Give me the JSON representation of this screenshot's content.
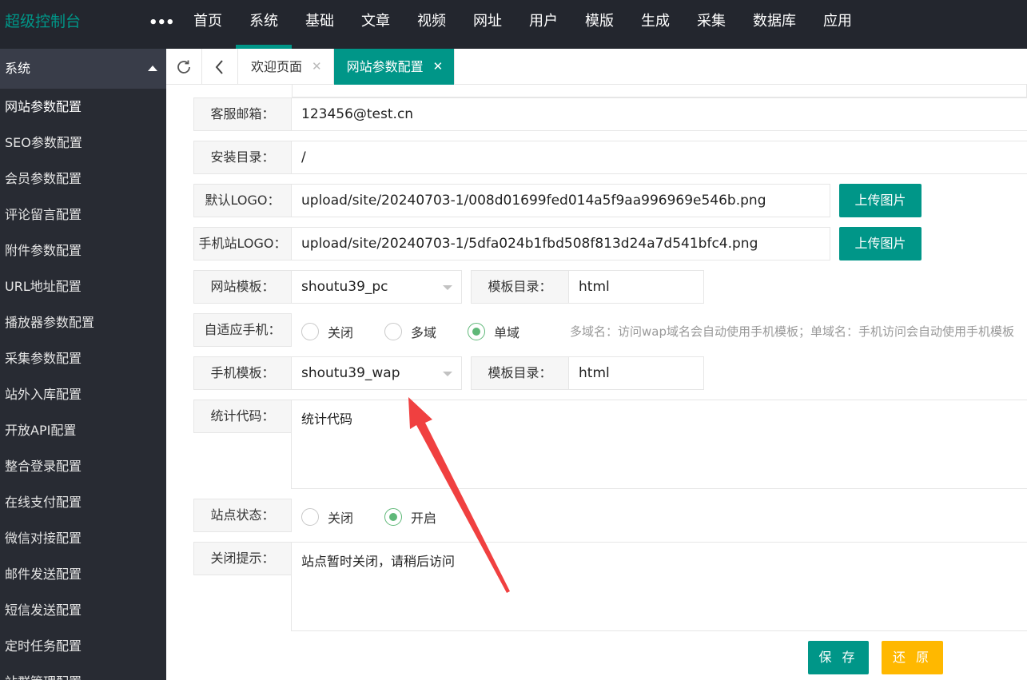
{
  "header": {
    "brand": "超级控制台",
    "more": "•••",
    "nav": [
      "首页",
      "系统",
      "基础",
      "文章",
      "视频",
      "网址",
      "用户",
      "模版",
      "生成",
      "采集",
      "数据库",
      "应用"
    ]
  },
  "sidebar": {
    "title": "系统",
    "items": [
      "网站参数配置",
      "SEO参数配置",
      "会员参数配置",
      "评论留言配置",
      "附件参数配置",
      "URL地址配置",
      "播放器参数配置",
      "采集参数配置",
      "站外入库配置",
      "开放API配置",
      "整合登录配置",
      "在线支付配置",
      "微信对接配置",
      "邮件发送配置",
      "短信发送配置",
      "定时任务配置",
      "站群管理配置"
    ]
  },
  "tabs": [
    {
      "label": "欢迎页面",
      "close": "✕"
    },
    {
      "label": "网站参数配置",
      "close": "✕"
    }
  ],
  "form": {
    "email": {
      "label": "客服邮箱：",
      "value": "123456@test.cn"
    },
    "install_dir": {
      "label": "安装目录：",
      "value": "/"
    },
    "logo": {
      "label": "默认LOGO：",
      "value": "upload/site/20240703-1/008d01699fed014a5f9aa996969e546b.png",
      "button": "上传图片"
    },
    "mobile_logo": {
      "label": "手机站LOGO：",
      "value": "upload/site/20240703-1/5dfa024b1fbd508f813d24a7d541bfc4.png",
      "button": "上传图片"
    },
    "site_template": {
      "label": "网站模板：",
      "value": "shoutu39_pc",
      "dir_label": "模板目录：",
      "dir_value": "html"
    },
    "adaptive": {
      "label": "自适应手机：",
      "options": [
        "关闭",
        "多域",
        "单域"
      ],
      "selected": "单域",
      "hint": "多域名：访问wap域名会自动使用手机模板；单域名：手机访问会自动使用手机模板"
    },
    "mobile_template": {
      "label": "手机模板：",
      "value": "shoutu39_wap",
      "dir_label": "模板目录：",
      "dir_value": "html"
    },
    "stats": {
      "label": "统计代码：",
      "value": "统计代码"
    },
    "status": {
      "label": "站点状态：",
      "options": [
        "关闭",
        "开启"
      ],
      "selected": "开启"
    },
    "close_tip": {
      "label": "关闭提示：",
      "value": "站点暂时关闭，请稍后访问"
    }
  },
  "actions": {
    "save": "保 存",
    "reset": "还 原"
  },
  "colors": {
    "accent": "#009688",
    "topbar": "#23262e",
    "sidebar": "#282b33",
    "reset": "#ffb800",
    "annotation_arrow": "#f04040"
  }
}
